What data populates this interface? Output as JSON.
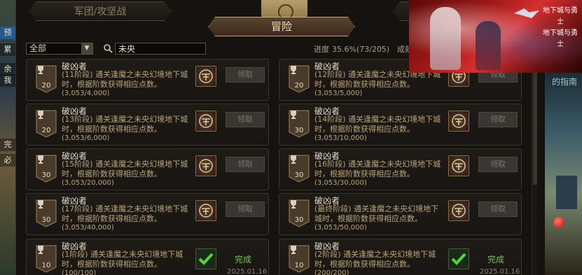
{
  "left_strip": {
    "items": [
      "预",
      "累",
      "余",
      "我",
      "完",
      "必"
    ]
  },
  "tabs": {
    "left": "军团/攻坚战",
    "active": "冒险"
  },
  "filter": {
    "category": "全部",
    "search_value": "未央",
    "progress_label": "进度",
    "progress_value": "35.6%(73/205)",
    "progress_tail": "成就"
  },
  "banner": {
    "logo_line1": "地下城与勇士",
    "logo_line2": "地下城与勇士"
  },
  "right_strip": {
    "text": "的指南"
  },
  "cards": [
    {
      "title": "破凶者",
      "desc": "(11阶段) 通关逢魔之未央幻境地下城时，根据阶数获得相应点数。",
      "progress": "(3,053/4,000)",
      "points": "20",
      "action": "领取",
      "done": false
    },
    {
      "title": "破凶者",
      "desc": "(12阶段) 通关逢魔之未央幻境地下城时，根据阶数获得相应点数。",
      "progress": "(3,053/5,000)",
      "points": "20",
      "action": "领取",
      "done": false
    },
    {
      "title": "破凶者",
      "desc": "(13阶段) 通关逢魔之未央幻境地下城时，根据阶数获得相应点数。",
      "progress": "(3,053/6,000)",
      "points": "20",
      "action": "领取",
      "done": false
    },
    {
      "title": "破凶者",
      "desc": "(14阶段) 通关逢魔之未央幻境地下城时，根据阶数获得相应点数。",
      "progress": "(3,053/10,000)",
      "points": "30",
      "action": "领取",
      "done": false
    },
    {
      "title": "破凶者",
      "desc": "(15阶段) 通关逢魔之未央幻境地下城时，根据阶数获得相应点数。",
      "progress": "(3,053/20,000)",
      "points": "30",
      "action": "领取",
      "done": false
    },
    {
      "title": "破凶者",
      "desc": "(16阶段) 通关逢魔之未央幻境地下城时，根据阶数获得相应点数。",
      "progress": "(3,053/30,000)",
      "points": "30",
      "action": "领取",
      "done": false
    },
    {
      "title": "破凶者",
      "desc": "(17阶段) 通关逢魔之未央幻境地下城时，根据阶数获得相应点数。",
      "progress": "(3,053/40,000)",
      "points": "30",
      "action": "领取",
      "done": false
    },
    {
      "title": "破凶者",
      "desc": "(最终阶段) 通关逢魔之未央幻境地下城时，根据阶数获得相应点数。",
      "progress": "(3,053/50,000)",
      "points": "30",
      "action": "领取",
      "done": false
    },
    {
      "title": "破凶者",
      "desc": "(1阶段) 通关逢魔之未央幻境地下城时，根据阶数获得相应点数。",
      "progress": "(100/100)",
      "points": "10",
      "action": "完成",
      "date": "2025.01.16",
      "done": true
    },
    {
      "title": "破凶者",
      "desc": "(2阶段) 通关逢魔之未央幻境地下城时，根据阶数获得相应点数。",
      "progress": "(200/200)",
      "points": "10",
      "action": "完成",
      "date": "2025.01.16",
      "done": true
    }
  ],
  "colors": {
    "accent": "#c8a570",
    "done": "#7cc060"
  }
}
